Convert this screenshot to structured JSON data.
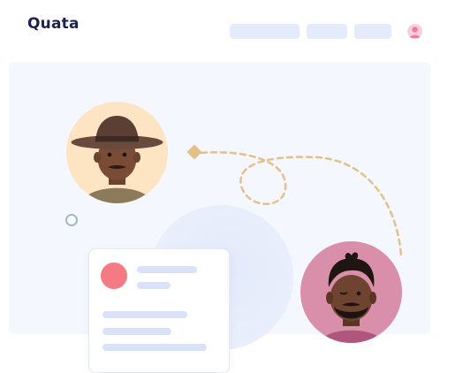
{
  "header": {
    "brand": "Quata",
    "nav_items": 3,
    "avatar_icon": "user-icon"
  },
  "illustration": {
    "portrait_left": {
      "icon": "avatar-man-cowboy-hat",
      "background": "#fde4c3"
    },
    "portrait_right": {
      "icon": "avatar-man-beard",
      "background": "#d98fa9"
    },
    "connector_color": "#e3c08a",
    "card_accent": "#f57a83",
    "skeleton_color": "#d9e2f8"
  }
}
